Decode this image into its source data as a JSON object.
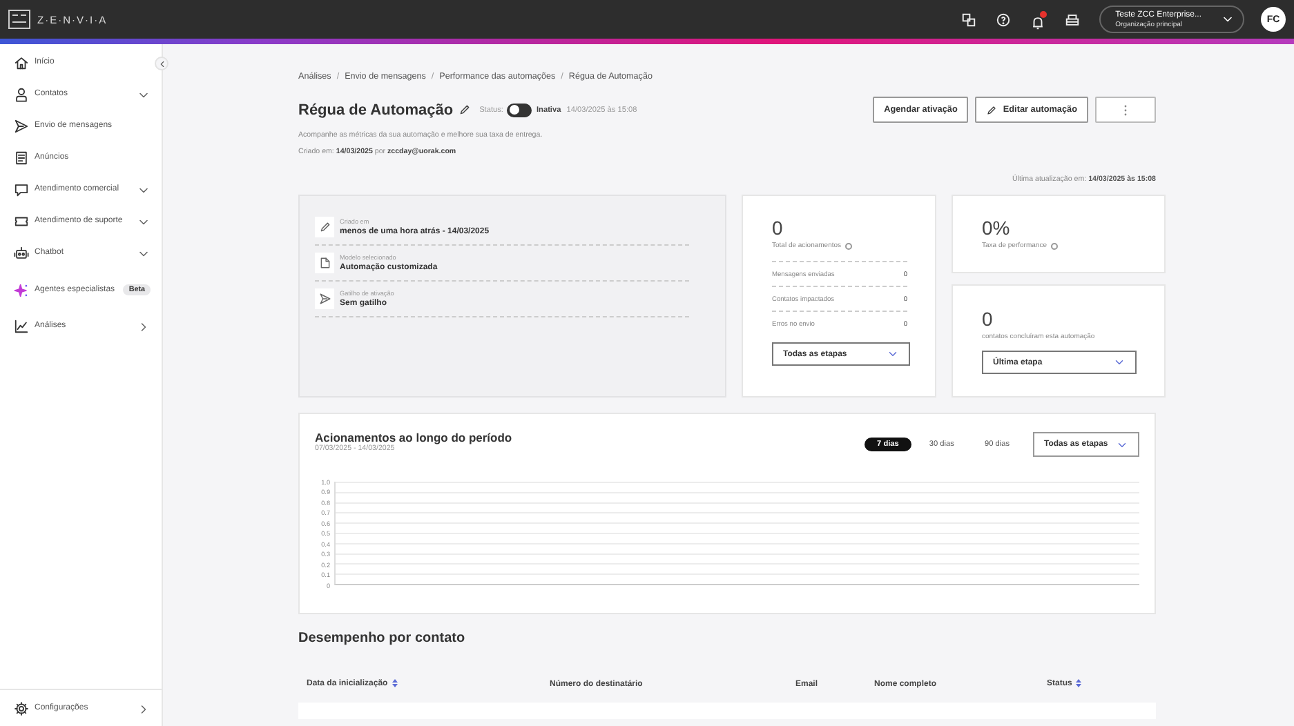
{
  "topbar": {
    "logo": "Z·E·N·V·I·A",
    "notification": true,
    "org_name": "Teste ZCC Enterprise...",
    "org_sub": "Organização principal",
    "avatar": "FC"
  },
  "sidebar": {
    "items": [
      {
        "label": "Início"
      },
      {
        "label": "Contatos"
      },
      {
        "label": "Envio de mensagens"
      },
      {
        "label": "Anúncios"
      },
      {
        "label": "Atendimento comercial"
      },
      {
        "label": "Atendimento de suporte"
      },
      {
        "label": "Chatbot"
      },
      {
        "label": "Agentes especialistas",
        "badge": "Beta"
      },
      {
        "label": "Análises"
      }
    ],
    "footer_item": {
      "label": "Configurações"
    }
  },
  "breadcrumb": [
    {
      "kind": "link",
      "text": "Análises"
    },
    {
      "kind": "separator",
      "text": "/"
    },
    {
      "kind": "link",
      "text": "Envio de mensagens"
    },
    {
      "kind": "separator",
      "text": "/"
    },
    {
      "kind": "link",
      "text": "Performance das automações"
    },
    {
      "kind": "separator",
      "text": "/"
    },
    {
      "kind": "current",
      "text": "Régua de Automação"
    }
  ],
  "header": {
    "title": "Régua de Automação",
    "status_label": "Status:",
    "status_on": false,
    "status_text": "Inativa",
    "status_date": "14/03/2025 às 15:08",
    "description": "Acompanhe as métricas da sua automação e melhore sua taxa de entrega.",
    "created": "Criado em: **14/03/2025** por **zccday@uorak.com**"
  },
  "buttons": [
    {
      "kind": "text",
      "label": "Agendar ativação"
    },
    {
      "kind": "pencil",
      "label": "Editar automação"
    },
    {
      "kind": "more"
    }
  ],
  "last_update": "Última atualização em: **14/03/2025 às 15:08**",
  "info_items": [
    {
      "label": "Criado em",
      "value": "menos de uma hora atrás - 14/03/2025"
    },
    {
      "label": "Modelo selecionado",
      "value": "Automação customizada"
    },
    {
      "label": "Gatilho de ativação",
      "value": "Sem gatilho"
    }
  ],
  "triggers_card": {
    "value": "0",
    "label": "Total de acionamentos",
    "rows": [
      {
        "label": "Mensagens enviadas",
        "value": "0"
      },
      {
        "label": "Contatos impactados",
        "value": "0"
      },
      {
        "label": "Erros no envio",
        "value": "0"
      }
    ],
    "dropdown": "Todas as etapas"
  },
  "performance_card": {
    "value": "0%",
    "label": "Taxa de performance"
  },
  "completed_card": {
    "value": "0",
    "label": "contatos concluíram esta automação",
    "dropdown": "Última etapa"
  },
  "chart": {
    "title": "Acionamentos ao longo do período",
    "range": "07/03/2025 - 14/03/2025",
    "periods": [
      {
        "label": "7 dias",
        "selected": true
      },
      {
        "label": "30 dias",
        "selected": false
      },
      {
        "label": "90 dias",
        "selected": false
      }
    ],
    "dropdown": "Todas as etapas",
    "y_axis_labels": [
      "1.0",
      "0.9",
      "0.8",
      "0.7",
      "0.6",
      "0.5",
      "0.4",
      "0.3",
      "0.2",
      "0.1",
      "0"
    ]
  },
  "table": {
    "title": "Desempenho por contato",
    "columns": [
      {
        "label": "Data da inicialização",
        "sortable": true
      },
      {
        "label": "Número do destinatário",
        "sortable": false
      },
      {
        "label": "Email",
        "sortable": false
      },
      {
        "label": "Nome completo",
        "sortable": false
      },
      {
        "label": "Status",
        "sortable": true
      }
    ]
  }
}
